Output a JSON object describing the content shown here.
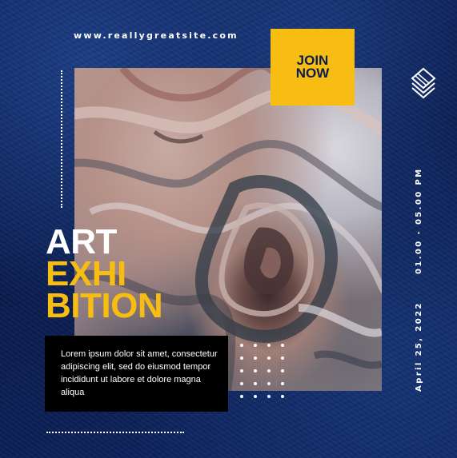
{
  "website": "www.reallygreatsite.com",
  "join_button": {
    "line1": "JOIN",
    "line2": "NOW"
  },
  "title": {
    "line1": "ART",
    "line2": "EXHI",
    "line3": "BITION"
  },
  "description": "Lorem ipsum dolor sit amet, consectetur adipiscing elit, sed do eiusmod tempor incididunt ut labore et dolore magna aliqua",
  "time": "01.00 - 05.00 PM",
  "date": "April 25, 2022",
  "colors": {
    "accent": "#f7bd12",
    "background": "#0f2460",
    "text": "#ffffff"
  },
  "icons": {
    "logo": "stacked-diamonds-icon"
  }
}
